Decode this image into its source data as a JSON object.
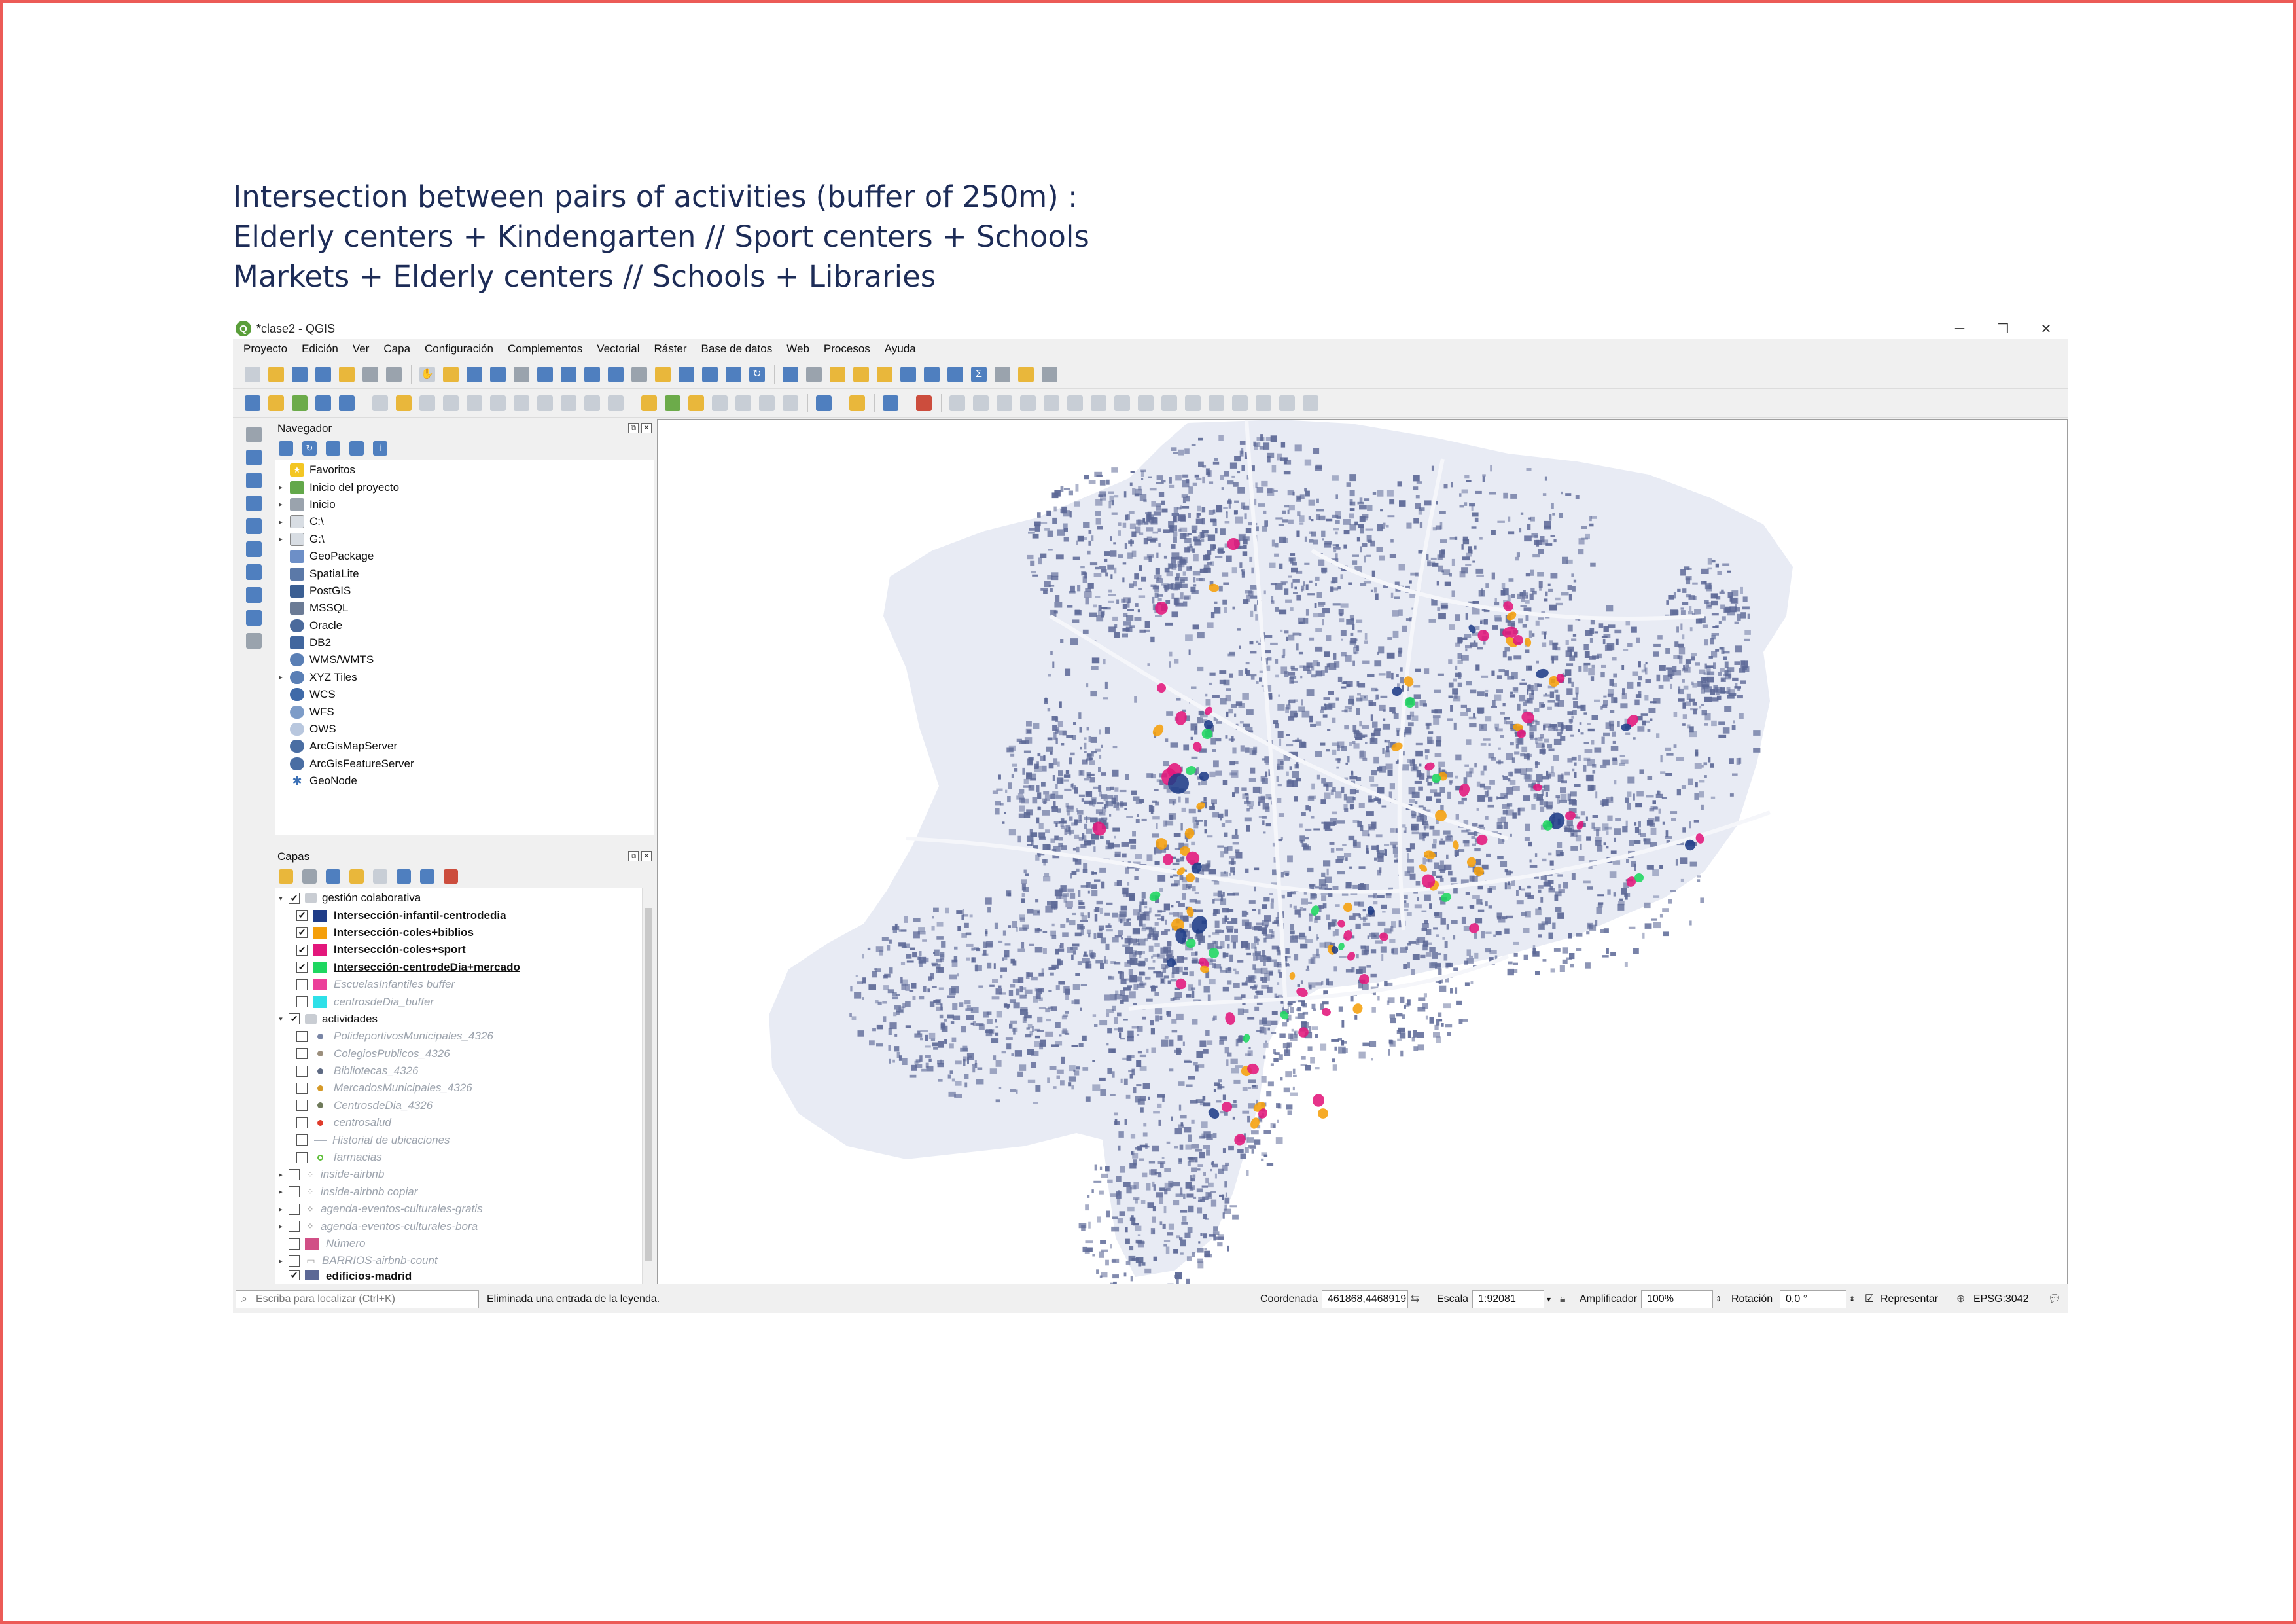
{
  "heading": {
    "line1": "Intersection between pairs of activities (buffer of 250m) :",
    "line2": "Elderly centers + Kindengarten // Sport centers + Schools",
    "line3": "Markets + Elderly centers // Schools + Libraries"
  },
  "window": {
    "title": "*clase2 - QGIS",
    "minimize": "─",
    "maximize": "❐",
    "close": "✕"
  },
  "menu": [
    "Proyecto",
    "Edición",
    "Ver",
    "Capa",
    "Configuración",
    "Complementos",
    "Vectorial",
    "Ráster",
    "Base de datos",
    "Web",
    "Procesos",
    "Ayuda"
  ],
  "browser": {
    "title": "Navegador",
    "items": [
      {
        "label": "Favoritos",
        "icon": "star-icon",
        "expand": ""
      },
      {
        "label": "Inicio del proyecto",
        "icon": "project-home-icon",
        "expand": "▸"
      },
      {
        "label": "Inicio",
        "icon": "home-folder-icon",
        "expand": "▸"
      },
      {
        "label": "C:\\",
        "icon": "drive-icon",
        "expand": "▸"
      },
      {
        "label": "G:\\",
        "icon": "drive-icon",
        "expand": "▸"
      },
      {
        "label": "GeoPackage",
        "icon": "geopackage-icon",
        "expand": ""
      },
      {
        "label": "SpatiaLite",
        "icon": "spatialite-icon",
        "expand": ""
      },
      {
        "label": "PostGIS",
        "icon": "postgis-icon",
        "expand": ""
      },
      {
        "label": "MSSQL",
        "icon": "mssql-icon",
        "expand": ""
      },
      {
        "label": "Oracle",
        "icon": "oracle-icon",
        "expand": ""
      },
      {
        "label": "DB2",
        "icon": "db2-icon",
        "expand": ""
      },
      {
        "label": "WMS/WMTS",
        "icon": "wms-icon",
        "expand": ""
      },
      {
        "label": "XYZ Tiles",
        "icon": "xyz-icon",
        "expand": "▸"
      },
      {
        "label": "WCS",
        "icon": "wcs-icon",
        "expand": ""
      },
      {
        "label": "WFS",
        "icon": "wfs-icon",
        "expand": ""
      },
      {
        "label": "OWS",
        "icon": "ows-icon",
        "expand": ""
      },
      {
        "label": "ArcGisMapServer",
        "icon": "arcgis-mapserver-icon",
        "expand": ""
      },
      {
        "label": "ArcGisFeatureServer",
        "icon": "arcgis-featureserver-icon",
        "expand": ""
      },
      {
        "label": "GeoNode",
        "icon": "geonode-icon",
        "expand": ""
      }
    ]
  },
  "layers": {
    "title": "Capas",
    "groups": {
      "gestion": "gestión colaborativa",
      "actividades": "actividades"
    },
    "buffers": [
      {
        "label": "Intersección-infantil-centrodedia",
        "color": "#1f3c88",
        "checked": "✔",
        "style": "bold"
      },
      {
        "label": "Intersección-coles+biblios",
        "color": "#f59f0a",
        "checked": "✔",
        "style": "bold"
      },
      {
        "label": "Intersección-coles+sport",
        "color": "#e3177b",
        "checked": "✔",
        "style": "bold"
      },
      {
        "label": "Intersección-centrodeDia+mercado",
        "color": "#1ed760",
        "checked": "✔",
        "style": "bold"
      },
      {
        "label": "EscuelasInfantiles buffer",
        "color": "#ec3f9a",
        "checked": "",
        "style": "ital"
      },
      {
        "label": "centrosdeDia_buffer",
        "color": "#2ee0e8",
        "checked": "",
        "style": "ital"
      }
    ],
    "activities": [
      {
        "label": "PolideportivosMunicipales_4326",
        "color": "#7a86a6"
      },
      {
        "label": "ColegiosPublicos_4326",
        "color": "#9c8f7d"
      },
      {
        "label": "Bibliotecas_4326",
        "color": "#5e6a83"
      },
      {
        "label": "MercadosMunicipales_4326",
        "color": "#d69a28"
      },
      {
        "label": "CentrosdeDia_4326",
        "color": "#6f7a5a"
      },
      {
        "label": "centrosalud",
        "color": "#e03c2c"
      },
      {
        "label": "Historial de ubicaciones",
        "color": "#a9b0bb"
      },
      {
        "label": "farmacias",
        "color": "#5fbf3a"
      }
    ],
    "others": [
      {
        "label": "inside-airbnb",
        "icon": "points-layer-icon"
      },
      {
        "label": "inside-airbnb copiar",
        "icon": "points-layer-icon"
      },
      {
        "label": "agenda-eventos-culturales-gratis",
        "icon": "points-layer-icon"
      },
      {
        "label": "agenda-eventos-culturales-bora",
        "icon": "points-layer-icon"
      }
    ],
    "numero": "Número",
    "barrios": "BARRIOS-airbnb-count",
    "edificios": "edificios-madrid"
  },
  "status": {
    "search_placeholder": "Escriba para localizar (Ctrl+K)",
    "message": "Eliminada una entrada de la leyenda.",
    "coord_label": "Coordenada",
    "coord_value": "461868,4468919",
    "scale_label": "Escala",
    "scale_value": "1:92081",
    "magnifier_label": "Amplificador",
    "magnifier_value": "100%",
    "rotation_label": "Rotación",
    "rotation_value": "0,0 °",
    "render_label": "Representar",
    "crs": "EPSG:3042"
  },
  "colors": {
    "navy": "#1f3c88",
    "orange": "#f59f0a",
    "magenta": "#e3177b",
    "green": "#1ed760",
    "buildings": "#5c6896",
    "ground": "#e8ebf4",
    "frame": "#ec5b57"
  }
}
